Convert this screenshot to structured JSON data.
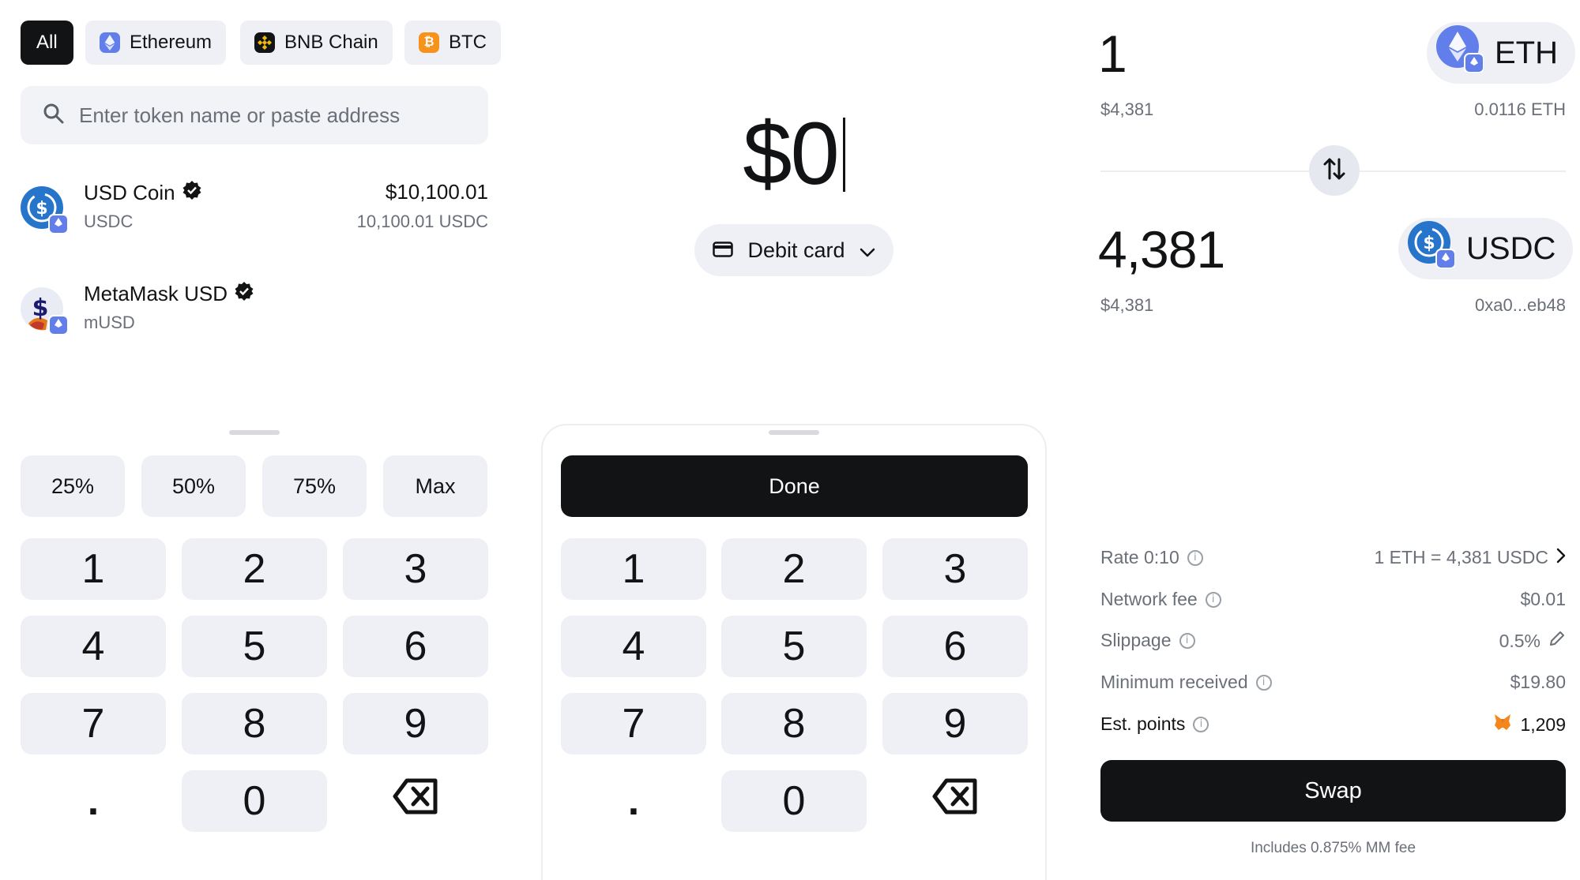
{
  "network_filter": {
    "chips": [
      {
        "label": "All",
        "active": true
      },
      {
        "label": "Ethereum",
        "icon": "ethereum-icon",
        "color": "#627eea"
      },
      {
        "label": "BNB Chain",
        "icon": "bnb-icon",
        "color": "#f0b90b"
      },
      {
        "label": "BTC",
        "icon": "bitcoin-icon",
        "color": "#f7931a"
      }
    ]
  },
  "search": {
    "placeholder": "Enter token name or paste address"
  },
  "tokens": [
    {
      "name": "USD Coin",
      "symbol": "USDC",
      "value": "$10,100.01",
      "amount": "10,100.01 USDC",
      "verified": true
    },
    {
      "name": "MetaMask USD",
      "symbol": "mUSD",
      "verified": true
    }
  ],
  "left_keypad": {
    "percent_buttons": [
      "25%",
      "50%",
      "75%",
      "Max"
    ],
    "keys": [
      "1",
      "2",
      "3",
      "4",
      "5",
      "6",
      "7",
      "8",
      "9",
      ".",
      "0"
    ]
  },
  "buy": {
    "amount": "$0",
    "payment_method": "Debit card",
    "done_label": "Done",
    "keys": [
      "1",
      "2",
      "3",
      "4",
      "5",
      "6",
      "7",
      "8",
      "9",
      ".",
      "0"
    ]
  },
  "swap": {
    "from": {
      "amount": "1",
      "fiat": "$4,381",
      "token": "ETH",
      "balance": "0.0116 ETH"
    },
    "to": {
      "amount": "4,381",
      "fiat": "$4,381",
      "token": "USDC",
      "address": "0xa0...eb48"
    },
    "details": [
      {
        "label": "Rate 0:10",
        "value": "1 ETH = 4,381 USDC"
      },
      {
        "label": "Network fee",
        "value": "$0.01"
      },
      {
        "label": "Slippage",
        "value": "0.5%"
      },
      {
        "label": "Minimum received",
        "value": "$19.80"
      },
      {
        "label": "Est. points",
        "value": "1,209"
      }
    ],
    "swap_label": "Swap",
    "fee_note": "Includes 0.875% MM fee"
  },
  "colors": {
    "accent_dark": "#121314",
    "surface": "#eef0f6",
    "muted_text": "#6a6f78",
    "usdc_blue": "#2775ca",
    "eth_purple": "#627eea",
    "metamask_orange": "#f6851b"
  }
}
